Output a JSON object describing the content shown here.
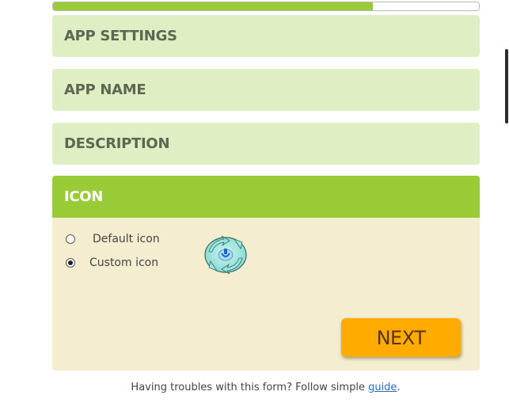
{
  "progress": {
    "value": 0.75
  },
  "sections": {
    "app_settings": {
      "title": "APP SETTINGS"
    },
    "app_name": {
      "title": "APP NAME"
    },
    "description": {
      "title": "DESCRIPTION"
    },
    "icon": {
      "title": "ICON",
      "options": [
        {
          "label": "Default icon",
          "checked": false
        },
        {
          "label": "Custom icon",
          "checked": true
        }
      ],
      "preview_icon": "custom-app-icon"
    }
  },
  "next_button": {
    "label": "NEXT"
  },
  "help": {
    "text": "Having troubles with this form? Follow simple",
    "link_text": "guide",
    "suffix": "."
  },
  "colors": {
    "accent_green": "#98cb36",
    "collapsed_section": "#e0efc3",
    "open_panel": "#f4edcf",
    "next_button": "#ffab00"
  }
}
